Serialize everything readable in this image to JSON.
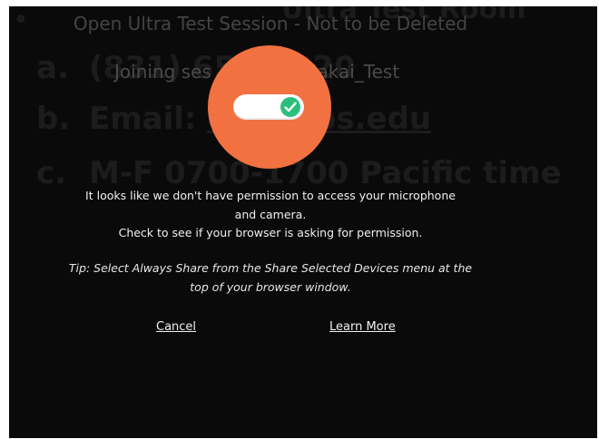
{
  "background_slide": {
    "bullet": "•",
    "title_partial": "Ultra Test Room",
    "line_a_letter": "a.",
    "line_a_text": "(831) 656-8820",
    "line_b_letter": "b.",
    "line_b_label": "Email: ",
    "line_b_link": "cet@nps.edu",
    "line_c_letter": "c.",
    "line_c_text": "M-F 0700-1700 Pacific time"
  },
  "session": {
    "title": "Open Ultra Test Session - Not to be Deleted",
    "joining_prefix": "Joining ses",
    "joining_suffix": "Sakai_Test"
  },
  "permission_dialog": {
    "message_line1": "It looks like we don't have permission to access your microphone",
    "message_line2": "and camera.",
    "message_line3": "Check to see if your browser is asking for permission.",
    "tip_line1": "Tip: Select Always Share from the Share Selected Devices menu at the",
    "tip_line2": "top of your browser window.",
    "cancel_label": "Cancel",
    "learn_more_label": "Learn More"
  },
  "icons": {
    "toggle": "toggle-switch-on-icon",
    "check": "checkmark-icon"
  },
  "colors": {
    "background": "#0a0a0a",
    "circle": "#f27141",
    "toggle_knob": "#2bbf7e",
    "text": "#f0f0f0"
  }
}
